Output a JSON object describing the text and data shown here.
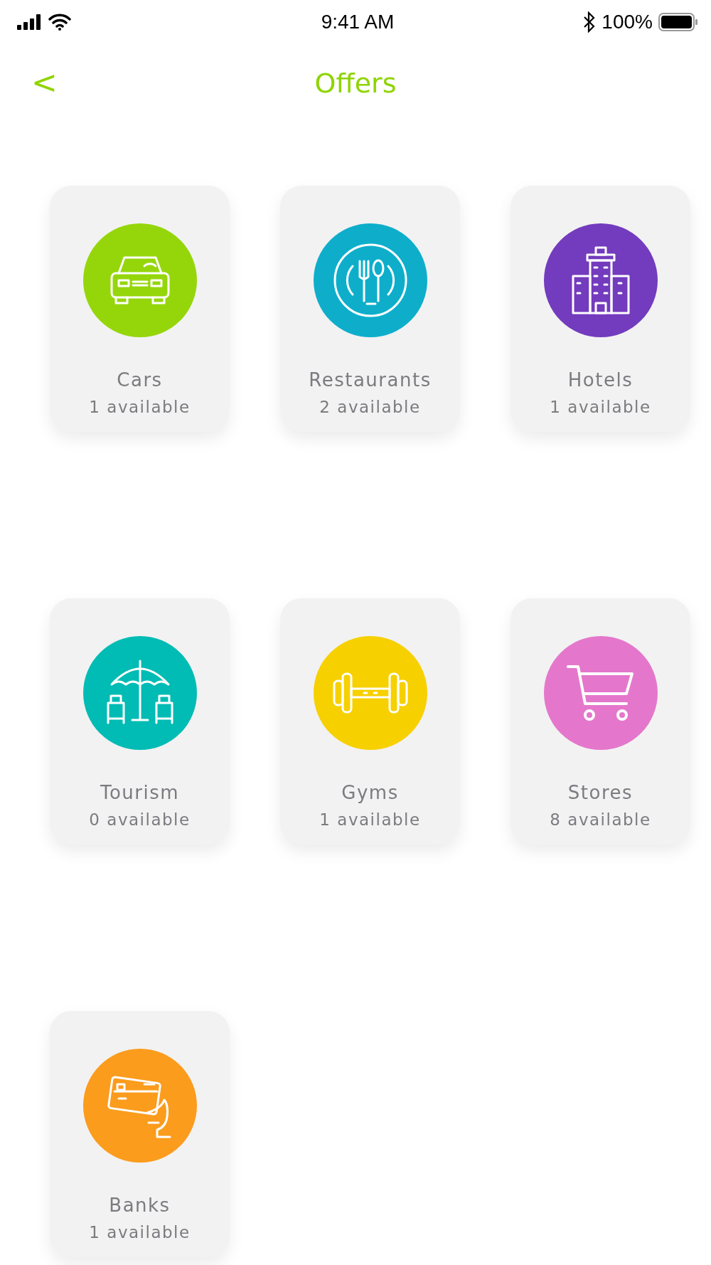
{
  "status_bar": {
    "time": "9:41 AM",
    "battery": "100%"
  },
  "header": {
    "back": "<",
    "title": "Offers"
  },
  "categories": [
    {
      "name": "Cars",
      "count": "1 available",
      "color": "#95d60a"
    },
    {
      "name": "Restaurants",
      "count": "2 available",
      "color": "#0eaecb"
    },
    {
      "name": "Hotels",
      "count": "1 available",
      "color": "#733bbd"
    },
    {
      "name": "Tourism",
      "count": "0 available",
      "color": "#00bcb4"
    },
    {
      "name": "Gyms",
      "count": "1 available",
      "color": "#f7d000"
    },
    {
      "name": "Stores",
      "count": "8 available",
      "color": "#e477cb"
    },
    {
      "name": "Banks",
      "count": "1 available",
      "color": "#fb9c1d"
    }
  ]
}
